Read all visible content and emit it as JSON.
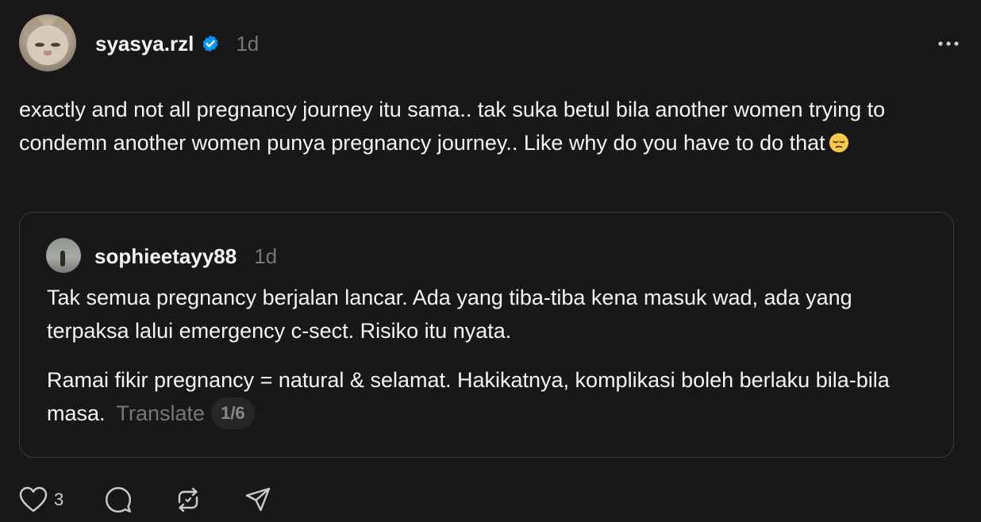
{
  "post": {
    "username": "syasya.rzl",
    "timestamp": "1d",
    "text": "exactly and not all pregnancy journey itu sama.. tak suka betul bila another women trying to condemn another women punya pregnancy journey.. Like why do you have to do that",
    "emoji": "pensive-face-emoji"
  },
  "quoted_post": {
    "username": "sophieetayy88",
    "timestamp": "1d",
    "paragraph_1": "Tak semua pregnancy berjalan lancar. Ada yang tiba-tiba kena masuk wad, ada yang terpaksa lalui emergency c-sect. Risiko itu nyata.",
    "paragraph_2": "Ramai fikir pregnancy = natural & selamat. Hakikatnya, komplikasi boleh berlaku bila-bila masa.",
    "translate_label": "Translate",
    "page_indicator": "1/6"
  },
  "actions": {
    "like_count": "3",
    "icons": [
      "heart-icon",
      "comment-icon",
      "repost-icon",
      "share-icon"
    ]
  },
  "colors": {
    "background": "#181818",
    "text": "#f3f5f7",
    "muted": "#777777",
    "verified": "#0095f6",
    "border": "#3a3a3a"
  }
}
